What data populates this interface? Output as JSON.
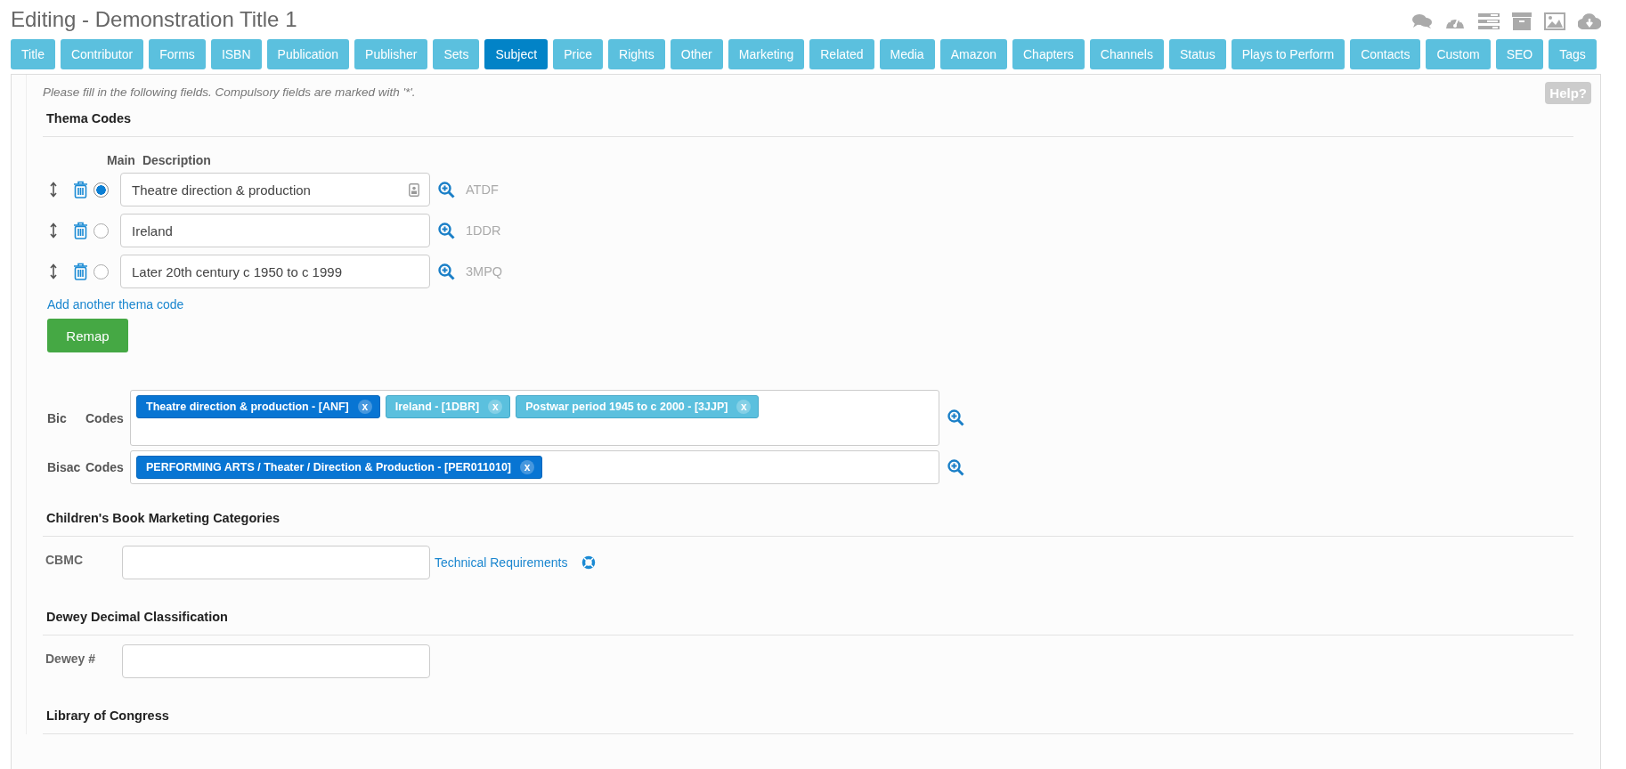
{
  "page_title": "Editing - Demonstration Title 1",
  "tabs": [
    {
      "label": "Title",
      "selected": false
    },
    {
      "label": "Contributor",
      "selected": false
    },
    {
      "label": "Forms",
      "selected": false
    },
    {
      "label": "ISBN",
      "selected": false
    },
    {
      "label": "Publication",
      "selected": false
    },
    {
      "label": "Publisher",
      "selected": false
    },
    {
      "label": "Sets",
      "selected": false
    },
    {
      "label": "Subject",
      "selected": true
    },
    {
      "label": "Price",
      "selected": false
    },
    {
      "label": "Rights",
      "selected": false
    },
    {
      "label": "Other",
      "selected": false
    },
    {
      "label": "Marketing",
      "selected": false
    },
    {
      "label": "Related",
      "selected": false
    },
    {
      "label": "Media",
      "selected": false
    },
    {
      "label": "Amazon",
      "selected": false
    },
    {
      "label": "Chapters",
      "selected": false
    },
    {
      "label": "Channels",
      "selected": false
    },
    {
      "label": "Status",
      "selected": false
    },
    {
      "label": "Plays to Perform",
      "selected": false
    },
    {
      "label": "Contacts",
      "selected": false
    },
    {
      "label": "Custom",
      "selected": false
    },
    {
      "label": "SEO",
      "selected": false
    },
    {
      "label": "Tags",
      "selected": false
    }
  ],
  "help_button": "Help?",
  "instructions": "Please fill in the following fields. Compulsory fields are marked with '*'.",
  "thema": {
    "heading": "Thema Codes",
    "columns": [
      "Main",
      "Description"
    ],
    "rows": [
      {
        "description": "Theatre direction & production",
        "code": "ATDF",
        "selected": true,
        "contact_icon": true
      },
      {
        "description": "Ireland",
        "code": "1DDR",
        "selected": false,
        "contact_icon": false
      },
      {
        "description": "Later 20th century c 1950 to c 1999",
        "code": "3MPQ",
        "selected": false,
        "contact_icon": false
      }
    ],
    "add_link": "Add another thema code",
    "remap_button": "Remap"
  },
  "code_fields": [
    {
      "label": [
        "Bic",
        "Codes"
      ],
      "tall": true,
      "tags": [
        {
          "text": "Theatre direction & production - [ANF]",
          "remove": "x",
          "selected": true
        },
        {
          "text": "Ireland - [1DBR]",
          "remove": "x",
          "selected": false
        },
        {
          "text": "Postwar period 1945 to c 2000 - [3JJP]",
          "remove": "x",
          "selected": false
        }
      ]
    },
    {
      "label": [
        "Bisac",
        "Codes"
      ],
      "tall": false,
      "tags": [
        {
          "text": "PERFORMING ARTS / Theater / Direction & Production - [PER011010]",
          "remove": "x",
          "selected": true
        }
      ]
    }
  ],
  "sections": [
    {
      "heading": "Children's Book Marketing Categories",
      "label": "CBMC",
      "link": "Technical Requirements"
    },
    {
      "heading": "Dewey Decimal Classification",
      "label": "Dewey #"
    },
    {
      "heading": "Library of Congress"
    }
  ]
}
